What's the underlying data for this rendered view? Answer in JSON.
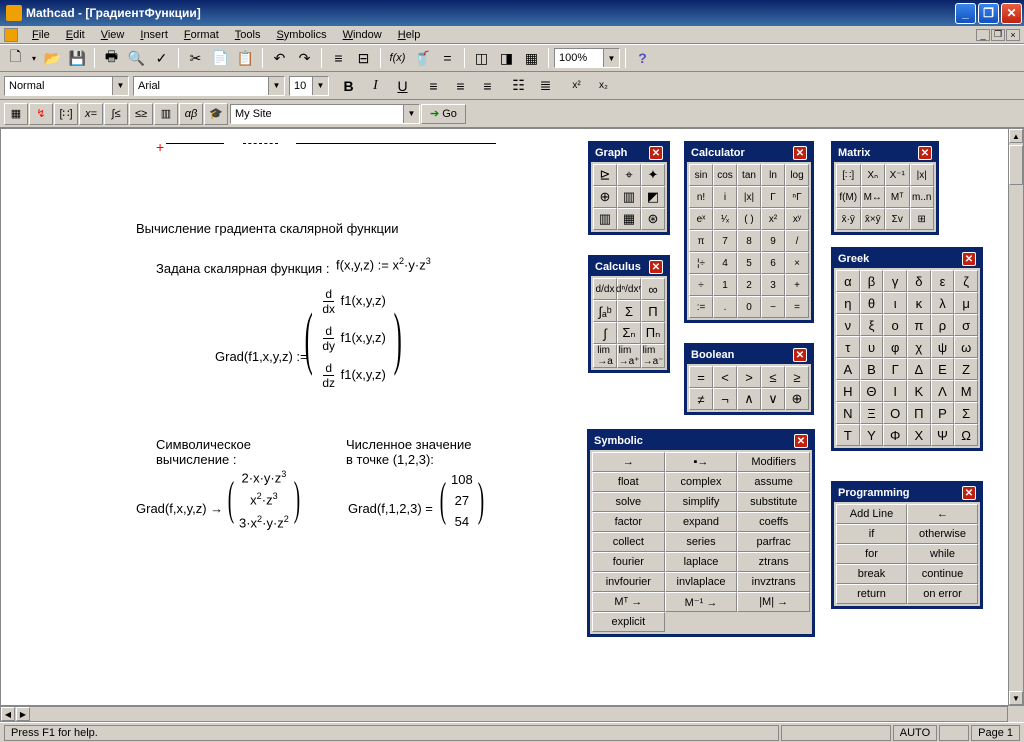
{
  "window": {
    "title": "Mathcad - [ГрадиентФункции]"
  },
  "menu": [
    "File",
    "Edit",
    "View",
    "Insert",
    "Format",
    "Tools",
    "Symbolics",
    "Window",
    "Help"
  ],
  "toolbar1": {
    "zoom": "100%"
  },
  "formatbar": {
    "style": "Normal",
    "font": "Arial",
    "size": "10"
  },
  "mathbar": {
    "site": "My Site",
    "go": "Go"
  },
  "doc": {
    "title": "Вычисление градиента скалярной функции",
    "given": "Задана скалярная функция :",
    "fdef": "f(x,y,z) := x²·y·z³",
    "grad_label": "Grad(f1,x,y,z) :=",
    "grad_d1": "f1(x,y,z)",
    "grad_d2": "f1(x,y,z)",
    "grad_d3": "f1(x,y,z)",
    "symbolic_label": "Символическое\nвычисление :",
    "numeric_label": "Численное значение\nв точке (1,2,3):",
    "sym_expr": "Grad(f,x,y,z) →",
    "sym_r1": "2·x·y·z³",
    "sym_r2": "x²·z³",
    "sym_r3": "3·x²·y·z²",
    "num_expr": "Grad(f,1,2,3) =",
    "num_r1": "108",
    "num_r2": "27",
    "num_r3": "54"
  },
  "palettes": {
    "graph": {
      "title": "Graph"
    },
    "calculus": {
      "title": "Calculus"
    },
    "calculator": {
      "title": "Calculator",
      "rows": [
        [
          "sin",
          "cos",
          "tan",
          "ln",
          "log"
        ],
        [
          "n!",
          "i",
          "|x|",
          "Γ",
          "ⁿΓ"
        ],
        [
          "eˣ",
          "¹⁄ₓ",
          "( )",
          "x²",
          "xʸ"
        ],
        [
          "π",
          "7",
          "8",
          "9",
          "/"
        ],
        [
          "¦÷",
          "4",
          "5",
          "6",
          "×"
        ],
        [
          "÷",
          "1",
          "2",
          "3",
          "+"
        ],
        [
          ":=",
          ".",
          "0",
          "−",
          "="
        ]
      ]
    },
    "boolean": {
      "title": "Boolean",
      "rows": [
        [
          "=",
          "<",
          ">",
          "≤",
          "≥"
        ],
        [
          "≠",
          "¬",
          "∧",
          "∨",
          "⊕"
        ]
      ]
    },
    "symbolic": {
      "title": "Symbolic",
      "rows": [
        [
          "→",
          "▪→",
          "Modifiers"
        ],
        [
          "float",
          "complex",
          "assume"
        ],
        [
          "solve",
          "simplify",
          "substitute"
        ],
        [
          "factor",
          "expand",
          "coeffs"
        ],
        [
          "collect",
          "series",
          "parfrac"
        ],
        [
          "fourier",
          "laplace",
          "ztrans"
        ],
        [
          "invfourier",
          "invlaplace",
          "invztrans"
        ],
        [
          "Mᵀ →",
          "M⁻¹ →",
          "|M| →"
        ],
        [
          "explicit",
          "",
          ""
        ]
      ]
    },
    "matrix": {
      "title": "Matrix",
      "rows": [
        [
          "[∷]",
          "Xₙ",
          "X⁻¹",
          "|x|"
        ],
        [
          "f(M)",
          "M↔",
          "Mᵀ",
          "m..n"
        ],
        [
          "x̄·ȳ",
          "x̄×ȳ",
          "Σv",
          "⊞"
        ]
      ]
    },
    "greek": {
      "title": "Greek",
      "rows": [
        [
          "α",
          "β",
          "γ",
          "δ",
          "ε",
          "ζ"
        ],
        [
          "η",
          "θ",
          "ι",
          "κ",
          "λ",
          "μ"
        ],
        [
          "ν",
          "ξ",
          "ο",
          "π",
          "ρ",
          "σ"
        ],
        [
          "τ",
          "υ",
          "φ",
          "χ",
          "ψ",
          "ω"
        ],
        [
          "Α",
          "Β",
          "Γ",
          "Δ",
          "Ε",
          "Ζ"
        ],
        [
          "Η",
          "Θ",
          "Ι",
          "Κ",
          "Λ",
          "Μ"
        ],
        [
          "Ν",
          "Ξ",
          "Ο",
          "Π",
          "Ρ",
          "Σ"
        ],
        [
          "Τ",
          "Υ",
          "Φ",
          "Χ",
          "Ψ",
          "Ω"
        ]
      ]
    },
    "programming": {
      "title": "Programming",
      "rows": [
        [
          "Add Line",
          "←"
        ],
        [
          "if",
          "otherwise"
        ],
        [
          "for",
          "while"
        ],
        [
          "break",
          "continue"
        ],
        [
          "return",
          "on error"
        ]
      ]
    }
  },
  "status": {
    "help": "Press F1 for help.",
    "auto": "AUTO",
    "page": "Page 1"
  }
}
